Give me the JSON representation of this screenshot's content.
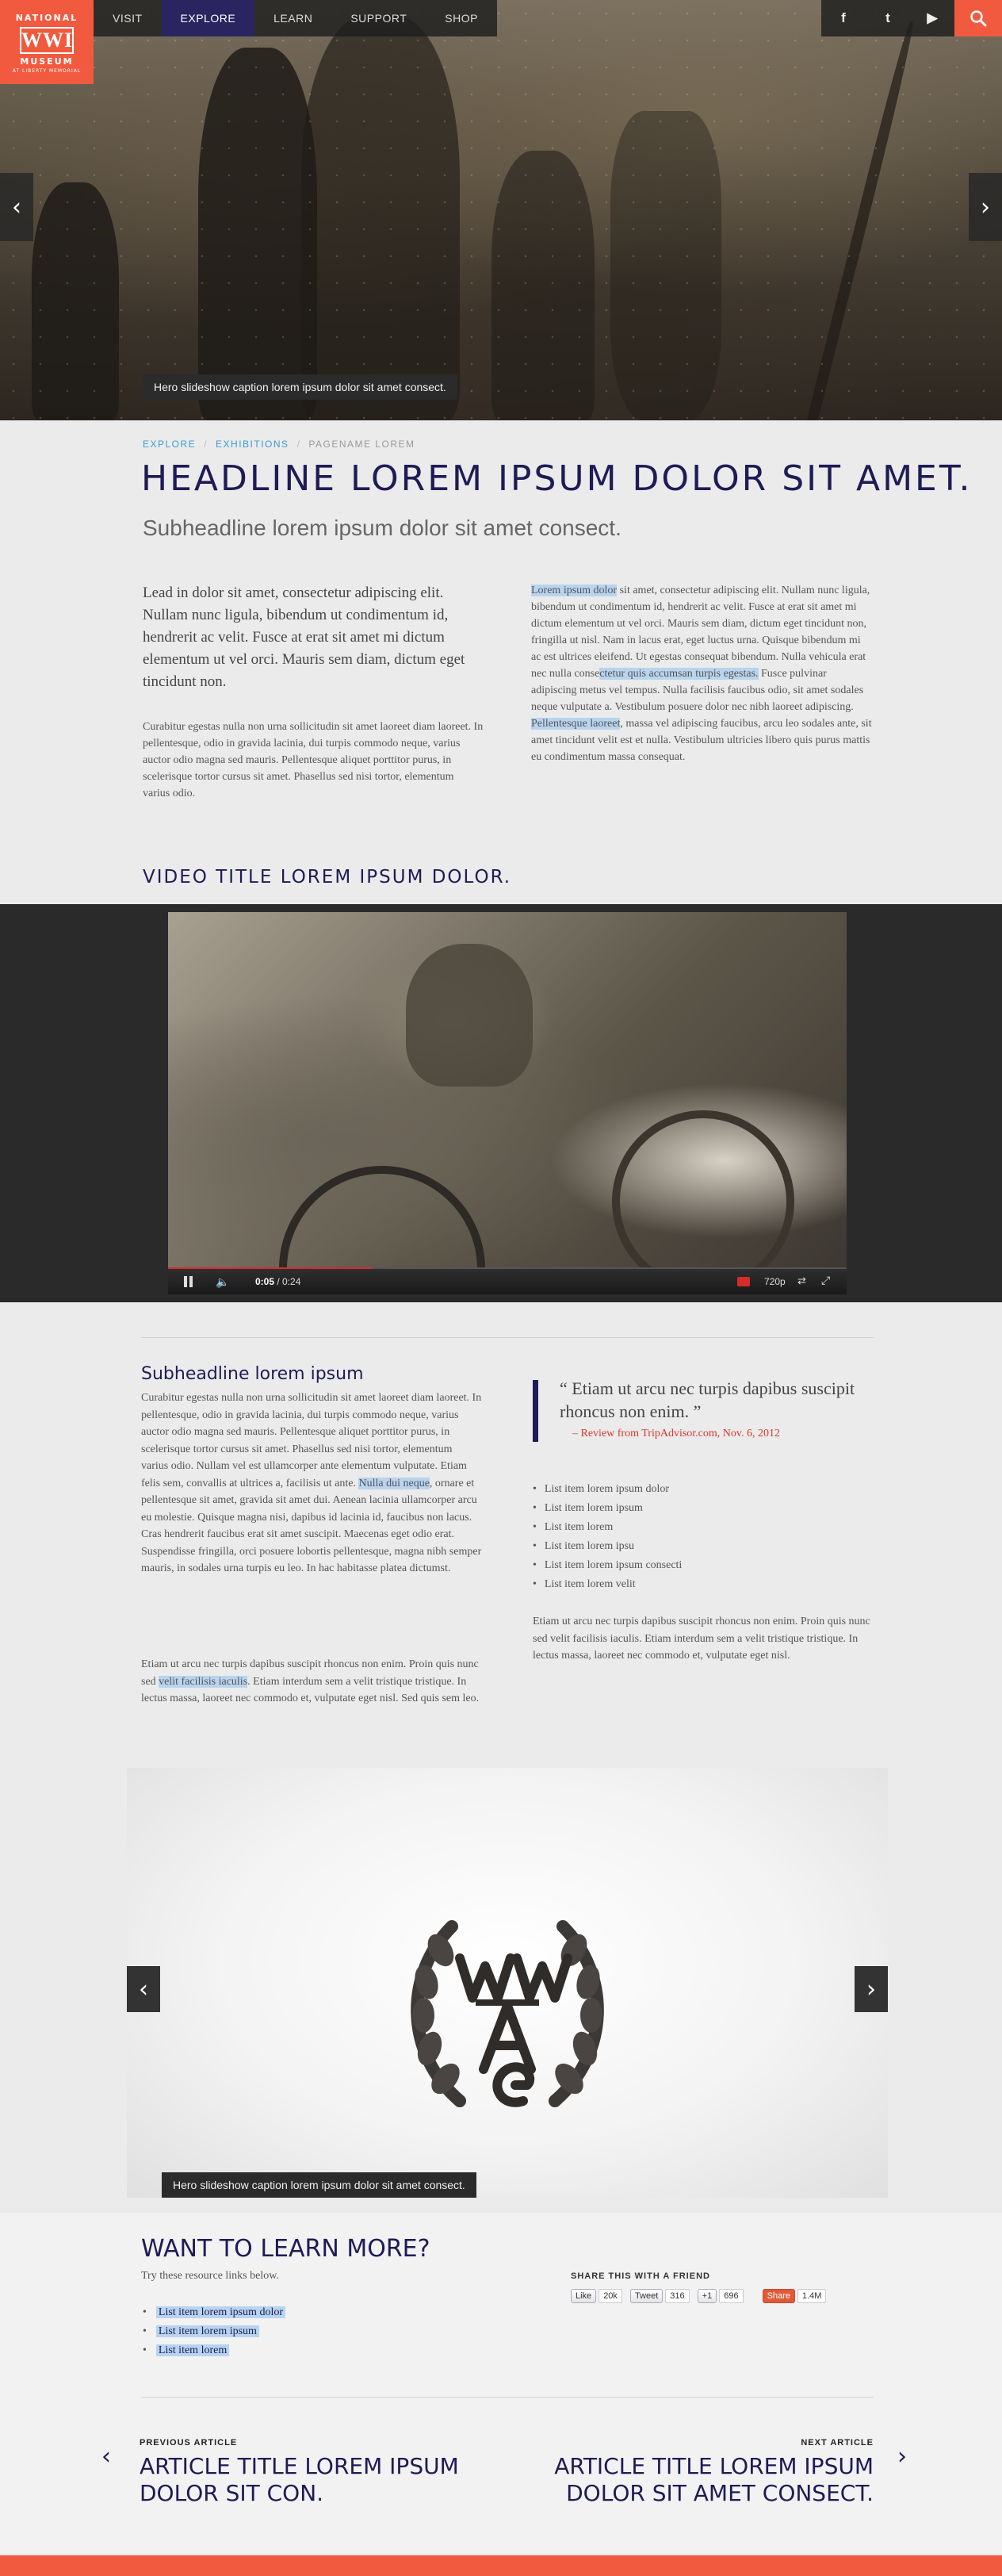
{
  "logo": {
    "line1": "NATIONAL",
    "line2": "WWI",
    "line3": "MUSEUM",
    "line4": "AT LIBERTY MEMORIAL"
  },
  "nav": {
    "items": [
      "VISIT",
      "EXPLORE",
      "LEARN",
      "SUPPORT",
      "SHOP"
    ],
    "active": "EXPLORE"
  },
  "social": {
    "icons": [
      "facebook-icon",
      "twitter-icon",
      "youtube-icon"
    ],
    "glyphs": [
      "f",
      "t",
      "▶"
    ]
  },
  "search": {
    "icon": "search-icon"
  },
  "hero": {
    "caption": "Hero slideshow caption lorem ipsum dolor sit amet consect."
  },
  "breadcrumb": [
    "EXPLORE",
    "EXHIBITIONS",
    "PAGENAME LOREM"
  ],
  "article": {
    "headline": "HEADLINE LOREM IPSUM DOLOR SIT AMET.",
    "subheadline": "Subheadline lorem ipsum dolor sit amet consect.",
    "lead": "Lead in dolor sit amet, consectetur adipiscing elit. Nullam nunc ligula, bibendum ut condimentum id, hendrerit ac velit. Fusce at erat sit amet mi dictum elementum ut vel orci. Mauris sem diam, dictum eget tincidunt non.",
    "body1": "Curabitur egestas nulla non urna sollicitudin sit amet laoreet diam laoreet. In pellentesque, odio in gravida lacinia, dui turpis commodo neque, varius auctor odio magna sed mauris. Pellentesque aliquet porttitor purus, in scelerisque tortor cursus sit amet. Phasellus sed nisi tortor, elementum varius odio.",
    "body2_hl1": "Lorem ipsum dolor",
    "body2_a": " sit amet, consectetur adipiscing elit. Nullam nunc ligula, bibendum ut condimentum id, hendrerit ac velit. Fusce at erat sit amet mi dictum elementum ut vel orci. Mauris sem diam, dictum eget tincidunt non, fringilla ut nisl. Nam in lacus erat, eget luctus urna. Quisque bibendum mi ac est ultrices eleifend. Ut egestas consequat bibendum. Nulla vehicula erat nec nulla conse",
    "body2_hl2": "ctetur quis accumsan turpis egestas.",
    "body2_b": " Fusce pulvinar adipiscing metus vel tempus. Nulla facilisis faucibus odio, sit amet sodales neque vulputate a. Vestibulum posuere dolor nec nibh laoreet adipiscing. ",
    "body2_hl3": "Pellentesque laoreet",
    "body2_c": ", massa vel adipiscing faucibus, arcu leo sodales ante, sit amet tincidunt velit est et nulla. Vestibulum ultricies libero quis purus mattis eu condimentum massa consequat."
  },
  "video": {
    "title": "VIDEO TITLE LOREM IPSUM DOLOR.",
    "time": "0:05",
    "duration": "0:24",
    "quality": "720p",
    "progress": 0.3
  },
  "section2": {
    "subheadline": "Subheadline lorem ipsum",
    "body3_a": "Curabitur egestas nulla non urna sollicitudin sit amet laoreet diam laoreet. In pellentesque, odio in gravida lacinia, dui turpis commodo neque, varius auctor odio magna sed mauris. Pellentesque aliquet porttitor purus, in scelerisque tortor cursus sit amet. Phasellus sed nisi tortor, elementum varius odio. Nullam vel est ullamcorper ante elementum vulputate. Etiam felis sem, convallis at ultrices a, facilisis ut ante. ",
    "body3_hl": "Nulla dui neque",
    "body3_b": ", ornare et pellentesque sit amet, gravida sit amet dui. Aenean lacinia ullamcorper arcu eu molestie. Quisque magna nisi, dapibus id lacinia id, faucibus non lacus. Cras hendrerit faucibus erat sit amet suscipit. Maecenas eget odio erat. Suspendisse fringilla, orci posuere lobortis pellentesque, magna nibh semper mauris, in sodales urna turpis eu leo. In hac habitasse platea dictumst.",
    "body4_a": "Etiam ut arcu nec turpis dapibus suscipit rhoncus non enim. Proin quis nunc sed ",
    "body4_hl": "velit facilisis iaculis",
    "body4_b": ". Etiam interdum sem a velit tristique tristique. In lectus massa, laoreet nec commodo et, vulputate eget nisl. Sed quis sem leo.",
    "quote": "“ Etiam ut arcu nec turpis dapibus suscipit rhoncus non enim. ”",
    "quote_source": "– Review from TripAdvisor.com, Nov. 6, 2012",
    "list": [
      "List item lorem ipsum dolor",
      "List item lorem ipsum",
      "List item lorem",
      "List item lorem ipsu",
      "List item lorem ipsum consecti",
      "List item lorem velit"
    ],
    "body5": "Etiam ut arcu nec turpis dapibus suscipit rhoncus non enim. Proin quis nunc sed velit facilisis iaculis. Etiam interdum sem a velit tristique tristique. In lectus massa, laoreet nec commodo et, vulputate eget nisl."
  },
  "gallery": {
    "caption": "Hero slideshow caption lorem ipsum dolor sit amet consect."
  },
  "learn": {
    "title": "WANT TO LEARN MORE?",
    "subtitle": "Try these resource links below.",
    "links": [
      "List item lorem ipsum dolor",
      "List item lorem ipsum",
      "List item lorem"
    ]
  },
  "share": {
    "title": "SHARE THIS WITH A FRIEND",
    "buttons": [
      {
        "label": "Like",
        "count": "20k"
      },
      {
        "label": "Tweet",
        "count": "316"
      },
      {
        "label": "+1",
        "count": "696"
      },
      {
        "label": "Share",
        "count": "1.4M"
      }
    ]
  },
  "pager": {
    "prev_label": "PREVIOUS ARTICLE",
    "prev_title": "ARTICLE TITLE LOREM IPSUM DOLOR SIT CON.",
    "next_label": "NEXT ARTICLE",
    "next_title": "ARTICLE TITLE LOREM IPSUM DOLOR SIT AMET CONSECT."
  },
  "colors": {
    "brand": "#f15a3f",
    "navy": "#1e1b56",
    "link": "#3a9bd5",
    "highlight": "#b8d4ef",
    "quote_source": "#d8392b"
  }
}
